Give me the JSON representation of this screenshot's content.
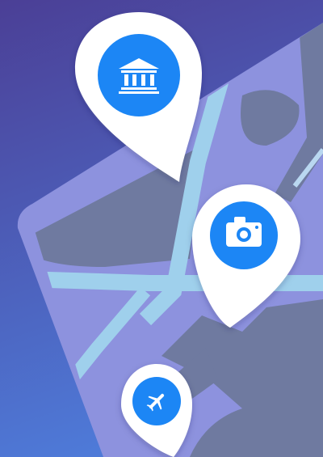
{
  "colors": {
    "gradient_top": "#4b3f96",
    "gradient_bottom": "#4e7ad8",
    "map_land": "#8d92de",
    "map_water": "#6f7aa0",
    "map_road": "#9fd0ec",
    "pin_fill": "#ffffff",
    "pin_accent": "#1a86f5"
  },
  "pins": [
    {
      "icon": "bank-icon",
      "label": "museum"
    },
    {
      "icon": "camera-icon",
      "label": "photo spot"
    },
    {
      "icon": "airplane-icon",
      "label": "airport"
    }
  ]
}
